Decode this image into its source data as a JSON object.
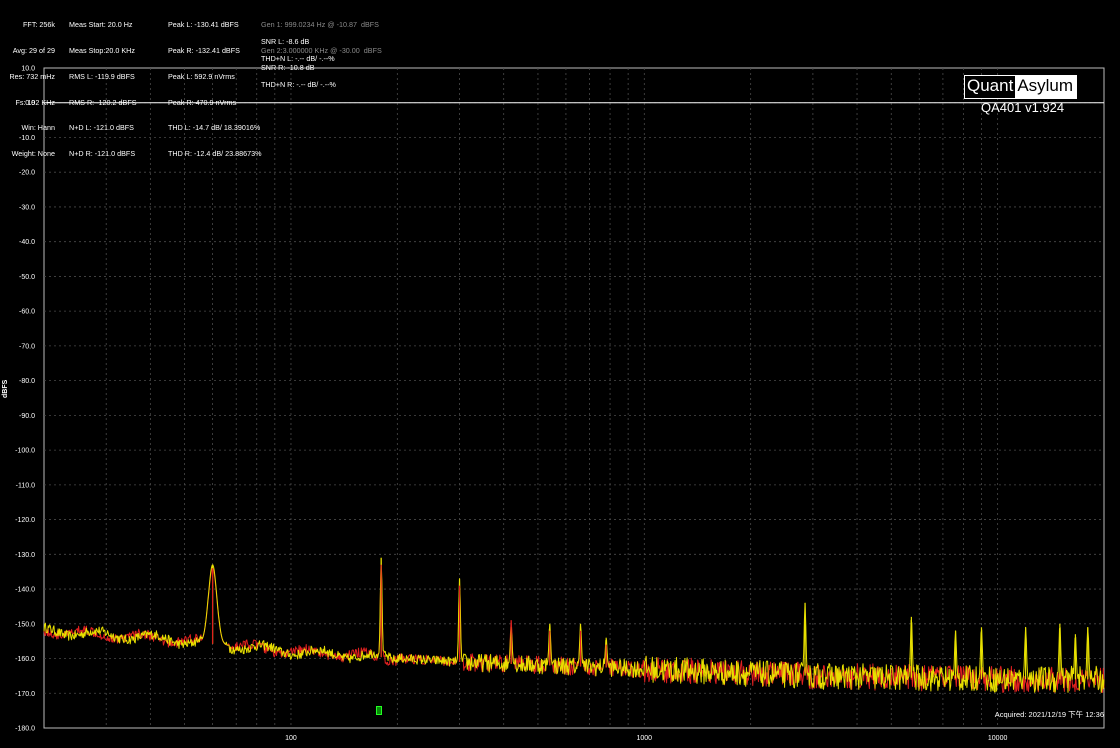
{
  "stats": {
    "col_a": [
      "FFT: 256k",
      "Avg: 29 of 29",
      "Res: 732 mHz",
      "Fs: 192 KHz",
      "Win: Hann",
      "Weight: None"
    ],
    "col_b": [
      "Meas Start: 20.0 Hz",
      "Meas Stop:20.0 KHz",
      "RMS L: -119.9 dBFS",
      "RMS R: -120.2 dBFS",
      "N+D L: -121.0 dBFS",
      "N+D R: -121.0 dBFS"
    ],
    "col_c": [
      "Peak L: -130.41 dBFS",
      "Peak R: -132.41 dBFS",
      "Peak L: 592.9 nVrms",
      "Peak R: 470.9 nVrms",
      "THD L: -14.7 dB/ 18.39016%",
      "THD R: -12.4 dB/ 23.88673%"
    ],
    "col_d": [
      "Gen 1: 999.0234 Hz @ -10.87  dBFS",
      "Gen 2:3.000000 KHz @ -30.00  dBFS"
    ],
    "col_e": [
      "SNR L: -8.6 dB",
      "SNR R: -10.8 dB"
    ],
    "col_f": [
      "THD+N L: -.-- dB/ -.--%",
      "THD+N R: -.-- dB/ -.--%"
    ]
  },
  "logo": {
    "quant": "Quant",
    "asylum": "Asylum"
  },
  "version": "QA401 v1.924",
  "acquired": "Acquired: 2021/12/19 下午 12:36",
  "colors": {
    "left": "#e8e000",
    "right": "#e02020",
    "reference": "#ffffff",
    "grid": "#4a4a4a"
  },
  "chart_data": {
    "type": "line",
    "title": "",
    "xlabel": "",
    "ylabel": "dBFS",
    "xscale": "log",
    "xlim": [
      20,
      20000
    ],
    "ylim": [
      -180,
      10
    ],
    "x_ticks": [
      "100",
      "1000",
      "10000"
    ],
    "y_ticks": [
      "10.0",
      "0.0",
      "-10.0",
      "-20.0",
      "-30.0",
      "-40.0",
      "-50.0",
      "-60.0",
      "-70.0",
      "-80.0",
      "-90.0",
      "-100.0",
      "-110.0",
      "-120.0",
      "-130.0",
      "-140.0",
      "-150.0",
      "-160.0",
      "-170.0",
      "-180.0"
    ],
    "grid": true,
    "reference_line": 0,
    "noise_floor": [
      [
        20,
        -152
      ],
      [
        40,
        -154
      ],
      [
        100,
        -158
      ],
      [
        300,
        -161
      ],
      [
        1000,
        -163
      ],
      [
        3000,
        -165
      ],
      [
        10000,
        -166
      ],
      [
        20000,
        -166
      ]
    ],
    "series": [
      {
        "name": "L",
        "color": "#e8e000",
        "peaks": [
          [
            60,
            -133
          ],
          [
            180,
            -131
          ],
          [
            300,
            -137
          ],
          [
            420,
            -151
          ],
          [
            540,
            -150
          ],
          [
            660,
            -150
          ],
          [
            780,
            -154
          ],
          [
            2850,
            -144
          ],
          [
            5700,
            -148
          ],
          [
            7600,
            -152
          ],
          [
            9000,
            -151
          ],
          [
            12000,
            -151
          ],
          [
            15000,
            -150
          ],
          [
            16600,
            -153
          ],
          [
            18000,
            -151
          ]
        ]
      },
      {
        "name": "R",
        "color": "#e02020",
        "peaks": [
          [
            60,
            -134
          ],
          [
            180,
            -133
          ],
          [
            300,
            -139
          ],
          [
            420,
            -149
          ],
          [
            540,
            -152
          ],
          [
            660,
            -152
          ],
          [
            780,
            -156
          ]
        ]
      }
    ]
  }
}
